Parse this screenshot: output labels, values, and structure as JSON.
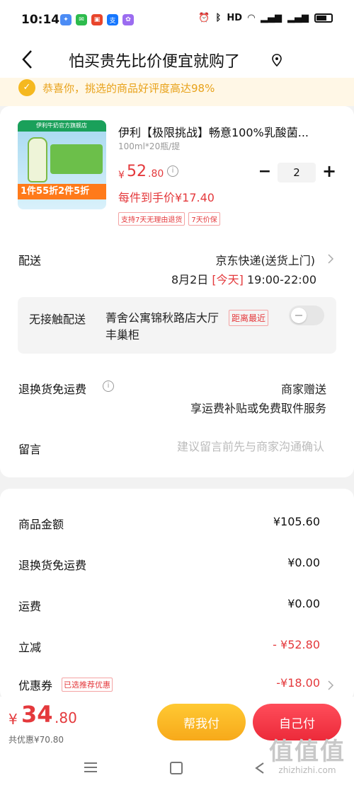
{
  "status_bar": {
    "time": "10:14",
    "right_text": "HD"
  },
  "header": {
    "title": "怕买贵先比价便宜就购了"
  },
  "banner": {
    "text": "恭喜你，挑选的商品好评度高达98%"
  },
  "product": {
    "image_shop_label": "伊利牛奶官方旗舰店",
    "image_promo": "1件55折2件5折",
    "title": "伊利【极限挑战】畅意100%乳酸菌...",
    "spec": "100ml*20瓶/提",
    "price_symbol": "¥",
    "price_integer": "52",
    "price_decimal": ".80",
    "quantity": "2",
    "minus_label": "−",
    "plus_label": "+",
    "unit_price_text": "每件到手价¥17.40",
    "tags": [
      "支持7天无理由退货",
      "7天价保"
    ]
  },
  "delivery": {
    "label": "配送",
    "method": "京东快递(送货上门)",
    "date": "8月2日",
    "today": "[今天]",
    "time": "19:00-22:00"
  },
  "no_contact": {
    "label": "无接触配送",
    "address": "菁舍公寓锦秋路店大厅丰巢柜",
    "tag": "距离最近",
    "enabled": false
  },
  "return_shipping": {
    "label": "退换货免运费",
    "value": "商家赠送",
    "desc": "享运费补贴或免费取件服务"
  },
  "message": {
    "label": "留言",
    "placeholder": "建议留言前先与商家沟通确认"
  },
  "summary": {
    "rows": [
      {
        "label": "商品金额",
        "value": "¥105.60"
      },
      {
        "label": "退换货免运费",
        "value": "¥0.00"
      },
      {
        "label": "运费",
        "value": "¥0.00"
      },
      {
        "label": "立减",
        "value": "- ¥52.80"
      },
      {
        "label": "优惠券",
        "value": "-¥18.00"
      }
    ],
    "coupon_tag": "已选推荐优惠"
  },
  "bottom": {
    "total_symbol": "¥",
    "total_integer": "34",
    "total_decimal": ".80",
    "discount_text": "共优惠¥70.80",
    "help_pay_label": "帮我付",
    "self_pay_label": "自己付"
  },
  "watermark": {
    "logo": "值值值",
    "url": "zhizhizhi.com"
  },
  "colors": {
    "accent_red": "#e4393c",
    "accent_yellow": "#f7a91a",
    "banner_bg": "#fff7e6"
  }
}
